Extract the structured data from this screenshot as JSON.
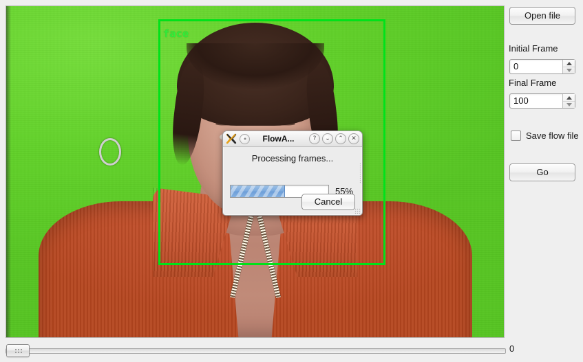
{
  "window": {
    "background_color": "#efefef"
  },
  "video": {
    "annotation": {
      "label": "face",
      "box_color": "#00e21a",
      "label_color": "#2ef03a"
    },
    "background_color": "#5fd329",
    "subject_description": "person in orange zip sweater on green screen"
  },
  "timeline": {
    "name": "frame-slider",
    "value": "0",
    "min": "0",
    "handle_position": "left"
  },
  "side_panel": {
    "open_file_label": "Open file",
    "initial_frame_label": "Initial Frame",
    "initial_frame_value": "0",
    "final_frame_label": "Final Frame",
    "final_frame_value": "100",
    "save_flow_label": "Save flow file",
    "save_flow_checked": "false",
    "go_label": "Go",
    "spinner_up_icon": "triangle-up-icon",
    "spinner_down_icon": "triangle-down-icon",
    "checkbox_icon": "checkbox-unchecked-icon"
  },
  "dialog": {
    "app_icon": "x-logo-icon",
    "menu_icon": "window-menu-icon",
    "title": "FlowA...",
    "help_label": "?",
    "minimize_label": "⌄",
    "maximize_label": "⌃",
    "close_label": "✕",
    "status_text": "Processing frames...",
    "progress_percent_label": "55%",
    "progress_value": 55,
    "cancel_label": "Cancel",
    "accent_color": "#7ba9dd"
  }
}
